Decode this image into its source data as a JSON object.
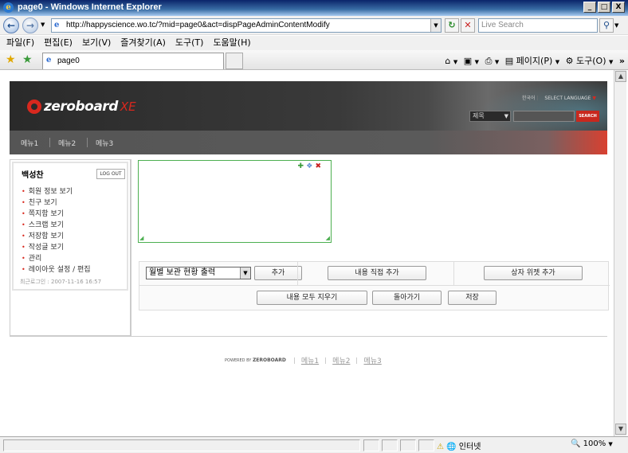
{
  "window": {
    "title": "page0 - Windows Internet Explorer",
    "minimize": "_",
    "maximize": "□",
    "close": "X"
  },
  "addressbar": {
    "url": "http://happyscience.wo.tc/?mid=page0&act=dispPageAdminContentModify",
    "search_placeholder": "Live Search"
  },
  "menubar": [
    "파일(F)",
    "편집(E)",
    "보기(V)",
    "즐겨찾기(A)",
    "도구(T)",
    "도움말(H)"
  ],
  "tabs": [
    {
      "label": "page0"
    }
  ],
  "commandbar": {
    "page": "페이지(P)",
    "tools": "도구(O)"
  },
  "site": {
    "logo_text": "zeroboard",
    "logo_suffix": "XE",
    "language_current": "한국어",
    "language_label": "SELECT LANGUAGE",
    "search_target": "제목",
    "search_button": "SEARCH",
    "nav": [
      "메뉴1",
      "메뉴2",
      "메뉴3"
    ]
  },
  "login": {
    "user": "백성찬",
    "logout": "LOG OUT",
    "links": [
      "회원 정보 보기",
      "친구 보기",
      "쪽지함 보기",
      "스크랩 보기",
      "저장함 보기",
      "작성글 보기",
      "관리",
      "레이아웃 설정 / 편집"
    ],
    "last_login_label": "최근로그인 : ",
    "last_login_value": "2007-11-16 16:57"
  },
  "editor": {
    "widget_select": "월별 보관 현황 출력",
    "add_button": "추가",
    "add_content_button": "내용 직접 추가",
    "add_box_widget_button": "상자 위젯 추가",
    "clear_all_button": "내용 모두 지우기",
    "back_button": "돌아가기",
    "save_button": "저장"
  },
  "footer": {
    "powered_prefix": "POWERED BY",
    "powered_brand": "ZEROBOARD",
    "links": [
      "메뉴1",
      "메뉴2",
      "메뉴3"
    ]
  },
  "statusbar": {
    "zone": "인터넷",
    "zoom": "100%"
  }
}
